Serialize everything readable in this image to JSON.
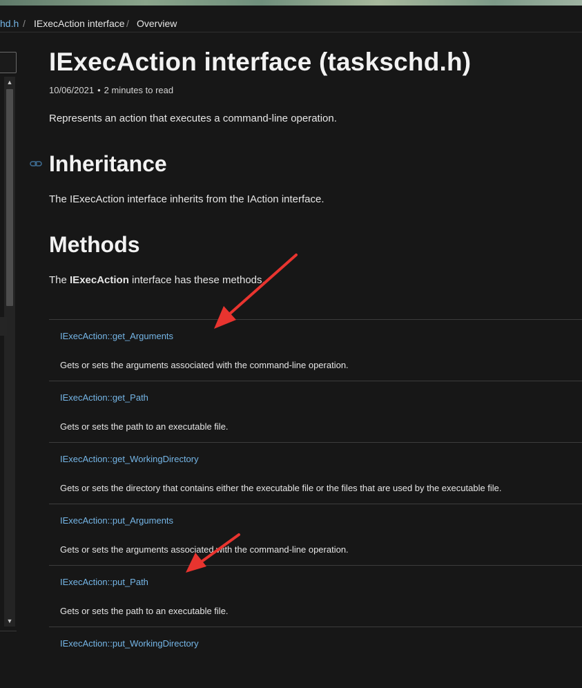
{
  "breadcrumb": {
    "items": [
      {
        "label": "hd.h",
        "kind": "link"
      },
      {
        "label": "IExecAction interface",
        "kind": "text"
      },
      {
        "label": "Overview",
        "kind": "text"
      }
    ],
    "separator": "/"
  },
  "article": {
    "title": "IExecAction interface (taskschd.h)",
    "date": "10/06/2021",
    "meta_dot": "•",
    "read_time": "2 minutes to read",
    "summary": "Represents an action that executes a command-line operation.",
    "inheritance": {
      "heading": "Inheritance",
      "text": "The IExecAction interface inherits from the IAction interface."
    },
    "methods": {
      "heading": "Methods",
      "intro_before": "The ",
      "intro_bold": "IExecAction",
      "intro_after": " interface has these methods.",
      "rows": [
        {
          "name": "IExecAction::get_Arguments",
          "description": "Gets or sets the arguments associated with the command-line operation."
        },
        {
          "name": "IExecAction::get_Path",
          "description": "Gets or sets the path to an executable file."
        },
        {
          "name": "IExecAction::get_WorkingDirectory",
          "description": "Gets or sets the directory that contains either the executable file or the files that are used by the executable file."
        },
        {
          "name": "IExecAction::put_Arguments",
          "description": "Gets or sets the arguments associated with the command-line operation."
        },
        {
          "name": "IExecAction::put_Path",
          "description": "Gets or sets the path to an executable file."
        },
        {
          "name": "IExecAction::put_WorkingDirectory",
          "description": ""
        }
      ]
    }
  },
  "colors": {
    "background": "#171717",
    "link": "#75b6e7",
    "text": "#e6e6e6",
    "annotation_arrow": "#e8342f"
  },
  "icons": {
    "heading_anchor": "link-icon",
    "scroll_up": "scroll-up-arrow-icon",
    "scroll_down": "scroll-down-arrow-icon"
  }
}
